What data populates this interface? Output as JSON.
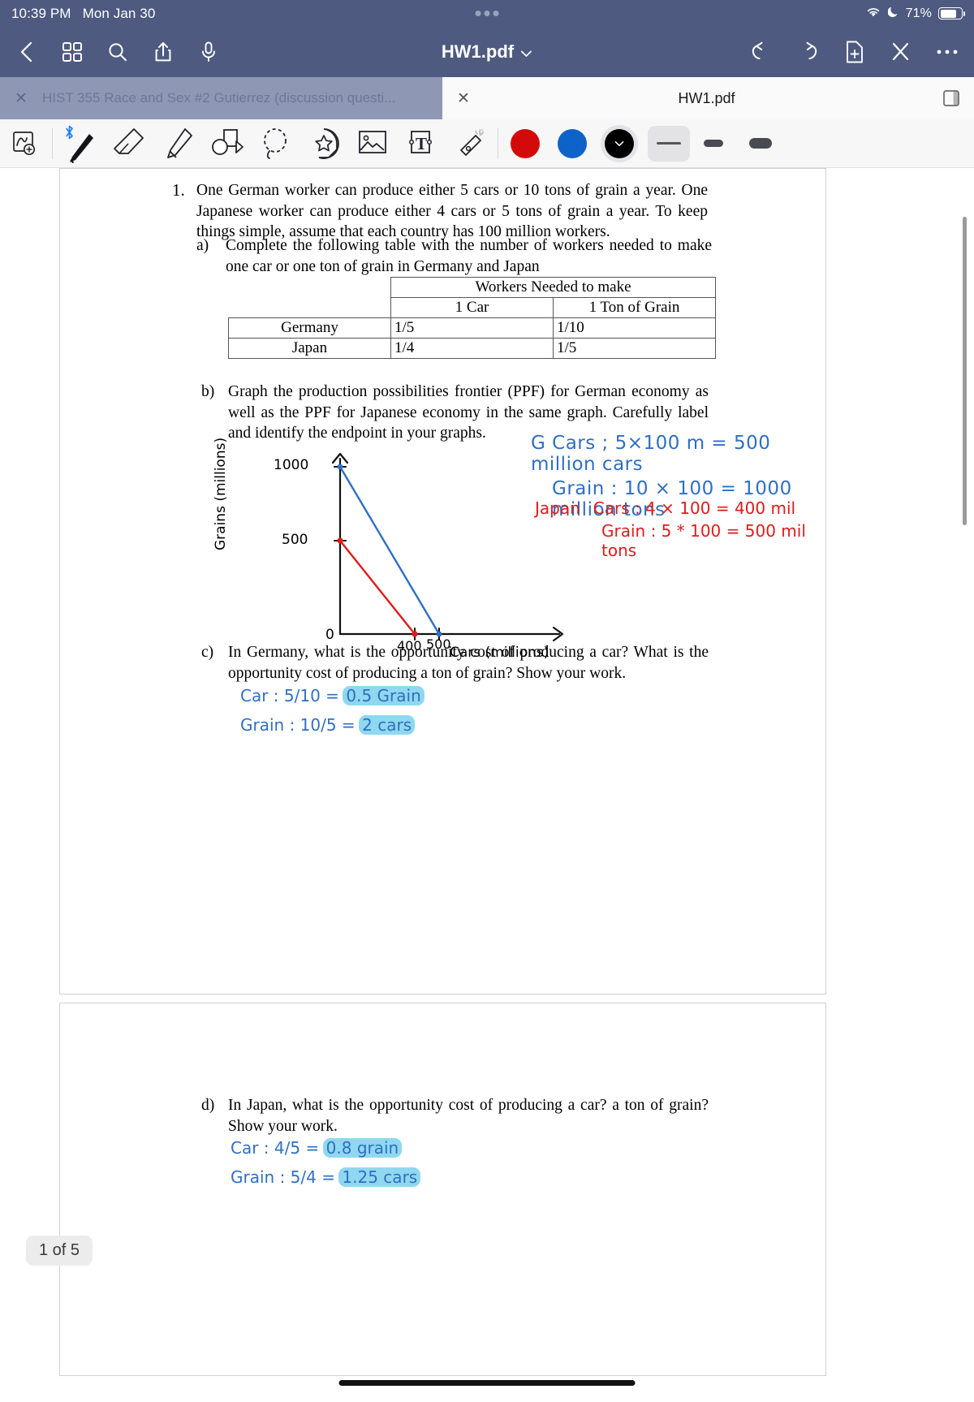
{
  "status_bar": {
    "time": "10:39 PM",
    "date": "Mon Jan 30",
    "battery_percent": "71%",
    "wifi_icon": "wifi-icon",
    "moon_icon": "do-not-disturb-icon"
  },
  "nav_bar": {
    "back_icon": "chevron-left-icon",
    "thumbnails_icon": "grid-thumbnails-icon",
    "search_icon": "search-icon",
    "share_icon": "share-icon",
    "mic_icon": "microphone-icon",
    "title": "HW1.pdf",
    "title_chevron": "chevron-down-icon",
    "undo_icon": "undo-icon",
    "redo_icon": "redo-icon",
    "add_page_icon": "add-page-icon",
    "close_annotation_icon": "scissors-icon",
    "more_icon": "more-options-icon"
  },
  "tabs": [
    {
      "label": "HIST 355  Race and Sex #2 Gutierrez (discussion questi...",
      "active": false,
      "close_icon": "close-icon"
    },
    {
      "label": "HW1.pdf",
      "active": true,
      "close_icon": "close-icon",
      "right_icon": "split-view-icon"
    }
  ],
  "annotation_toolbar": {
    "tools": [
      {
        "name": "zoom-box-tool",
        "label": "Zoom box"
      },
      {
        "name": "pen-tool",
        "label": "Pen",
        "bluetooth": true
      },
      {
        "name": "eraser-tool",
        "label": "Eraser"
      },
      {
        "name": "highlighter-tool",
        "label": "Highlighter"
      },
      {
        "name": "shapes-tool",
        "label": "Shapes"
      },
      {
        "name": "lasso-tool",
        "label": "Lasso select"
      },
      {
        "name": "sticker-tool",
        "label": "Sticker"
      },
      {
        "name": "image-tool",
        "label": "Insert image"
      },
      {
        "name": "text-tool",
        "label": "Text box"
      },
      {
        "name": "magic-eraser-tool",
        "label": "Magic eraser"
      }
    ],
    "colors": [
      {
        "name": "color-red",
        "hex": "#d40a0a",
        "selected": false
      },
      {
        "name": "color-blue",
        "hex": "#0d63c9",
        "selected": false
      },
      {
        "name": "color-black",
        "hex": "#000000",
        "selected": true
      }
    ],
    "widths": [
      {
        "name": "stroke-width-thin",
        "selected": true
      },
      {
        "name": "stroke-width-medium",
        "selected": false
      },
      {
        "name": "stroke-width-thick",
        "selected": false
      }
    ]
  },
  "document": {
    "page_indicator": "1 of 5",
    "question_number": "1.",
    "intro": "One German worker can produce either 5 cars or 10 tons of grain a year. One Japanese worker can produce either 4 cars or 5 tons of grain a year. To keep things simple, assume that each country has 100 million workers.",
    "part_a": {
      "label": "a)",
      "text": "Complete the following table with the number of workers needed to make one car or one ton of grain in Germany and Japan"
    },
    "table": {
      "super_header": "Workers Needed to make",
      "headers": [
        "1 Car",
        "1 Ton of Grain"
      ],
      "rows": [
        {
          "country": "Germany",
          "car": "1/5",
          "grain": "1/10"
        },
        {
          "country": "Japan",
          "car": "1/4",
          "grain": "1/5"
        }
      ]
    },
    "part_b": {
      "label": "b)",
      "text": "Graph the production possibilities frontier (PPF) for German economy as well as the PPF for Japanese economy in the same graph. Carefully label and identify the endpoint in your graphs."
    },
    "part_c": {
      "label": "c)",
      "text": "In Germany, what is the opportunity cost of producing a car? What is the opportunity cost of producing a ton of grain? Show your work."
    },
    "part_d": {
      "label": "d)",
      "text": "In Japan, what is the opportunity cost of producing a car? a ton of grain? Show your work."
    }
  },
  "annotations": {
    "germany_cars": "G Cars ; 5×100 m = 500 million cars",
    "germany_grain": "Grain : 10 × 100 = 1000 million tons",
    "japan_label": "Japan",
    "japan_cars": "Cars : 4 × 100 = 400 mil",
    "japan_grain": "Grain : 5 * 100 = 500 mil tons",
    "c_car": "Car : 5/10 =",
    "c_car_answer": "0.5 Grain",
    "c_grain": "Grain : 10/5 =",
    "c_grain_answer": "2 cars",
    "d_car": "Car : 4/5 =",
    "d_car_answer": "0.8 grain",
    "d_grain": "Grain : 5/4 =",
    "d_grain_answer": "1.25 cars"
  },
  "chart_data": {
    "type": "line",
    "title": "",
    "xlabel": "Cars (millions)",
    "ylabel": "Grains (millions)",
    "xlim": [
      0,
      700
    ],
    "ylim": [
      0,
      1150
    ],
    "xticks": [
      "400",
      "500"
    ],
    "yticks": [
      "500",
      "1000"
    ],
    "origin_label": "0",
    "grid": false,
    "legend": "none",
    "series": [
      {
        "name": "Germany PPF",
        "color": "#2f6fc4",
        "points": [
          [
            0,
            1000
          ],
          [
            500,
            0
          ]
        ],
        "endpoint_markers": [
          [
            0,
            1000
          ],
          [
            500,
            0
          ]
        ]
      },
      {
        "name": "Japan PPF",
        "color": "#e01b1b",
        "points": [
          [
            0,
            500
          ],
          [
            400,
            0
          ]
        ],
        "endpoint_markers": [
          [
            0,
            500
          ],
          [
            400,
            0
          ]
        ]
      }
    ]
  }
}
